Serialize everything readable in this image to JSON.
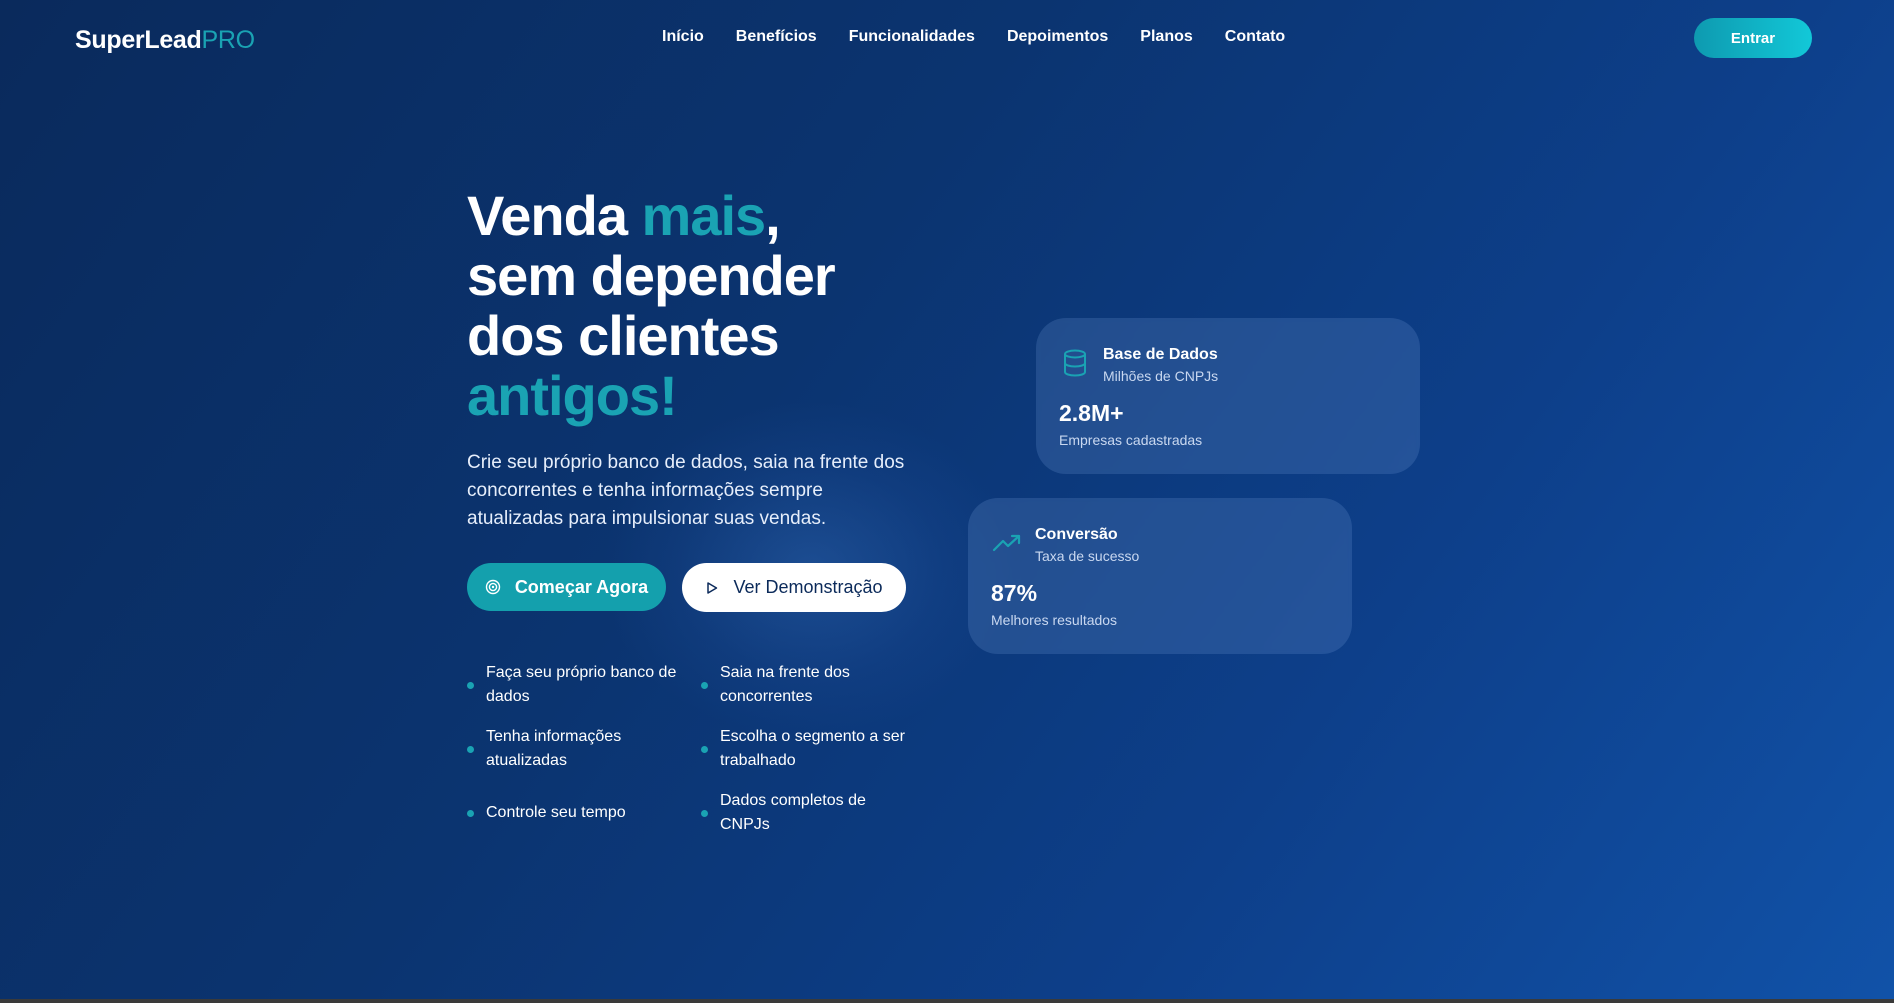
{
  "nav": {
    "logo_main": "SuperLead",
    "logo_accent": "PRO",
    "links": [
      "Início",
      "Benefícios",
      "Funcionalidades",
      "Depoimentos",
      "Planos",
      "Contato"
    ],
    "login_label": "Entrar"
  },
  "hero": {
    "title_line1_a": "Venda ",
    "title_line1_accent": "mais",
    "title_line1_b": ",",
    "title_line2": "sem depender",
    "title_line3": "dos clientes",
    "title_line4_accent": "antigos!",
    "subtitle": "Crie seu próprio banco de dados, saia na frente dos concorrentes e tenha informações sempre atualizadas para impulsionar suas vendas.",
    "primary_button": "Começar Agora",
    "secondary_button": "Ver Demonstração",
    "features": [
      "Faça seu próprio banco de dados",
      "Saia na frente dos concorrentes",
      "Tenha informações atualizadas",
      "Escolha o segmento a ser trabalhado",
      "Controle seu tempo",
      "Dados completos de CNPJs"
    ]
  },
  "cards": [
    {
      "icon": "database-icon",
      "title": "Base de Dados",
      "subtitle": "Milhões de CNPJs",
      "value": "2.8M+",
      "description": "Empresas cadastradas"
    },
    {
      "icon": "trending-up-icon",
      "title": "Conversão",
      "subtitle": "Taxa de sucesso",
      "value": "87%",
      "description": "Melhores resultados"
    }
  ],
  "colors": {
    "accent": "#1aa3b3",
    "primary_button": "#14a0ad",
    "background_start": "#0a2a5c",
    "background_end": "#1152a8"
  }
}
